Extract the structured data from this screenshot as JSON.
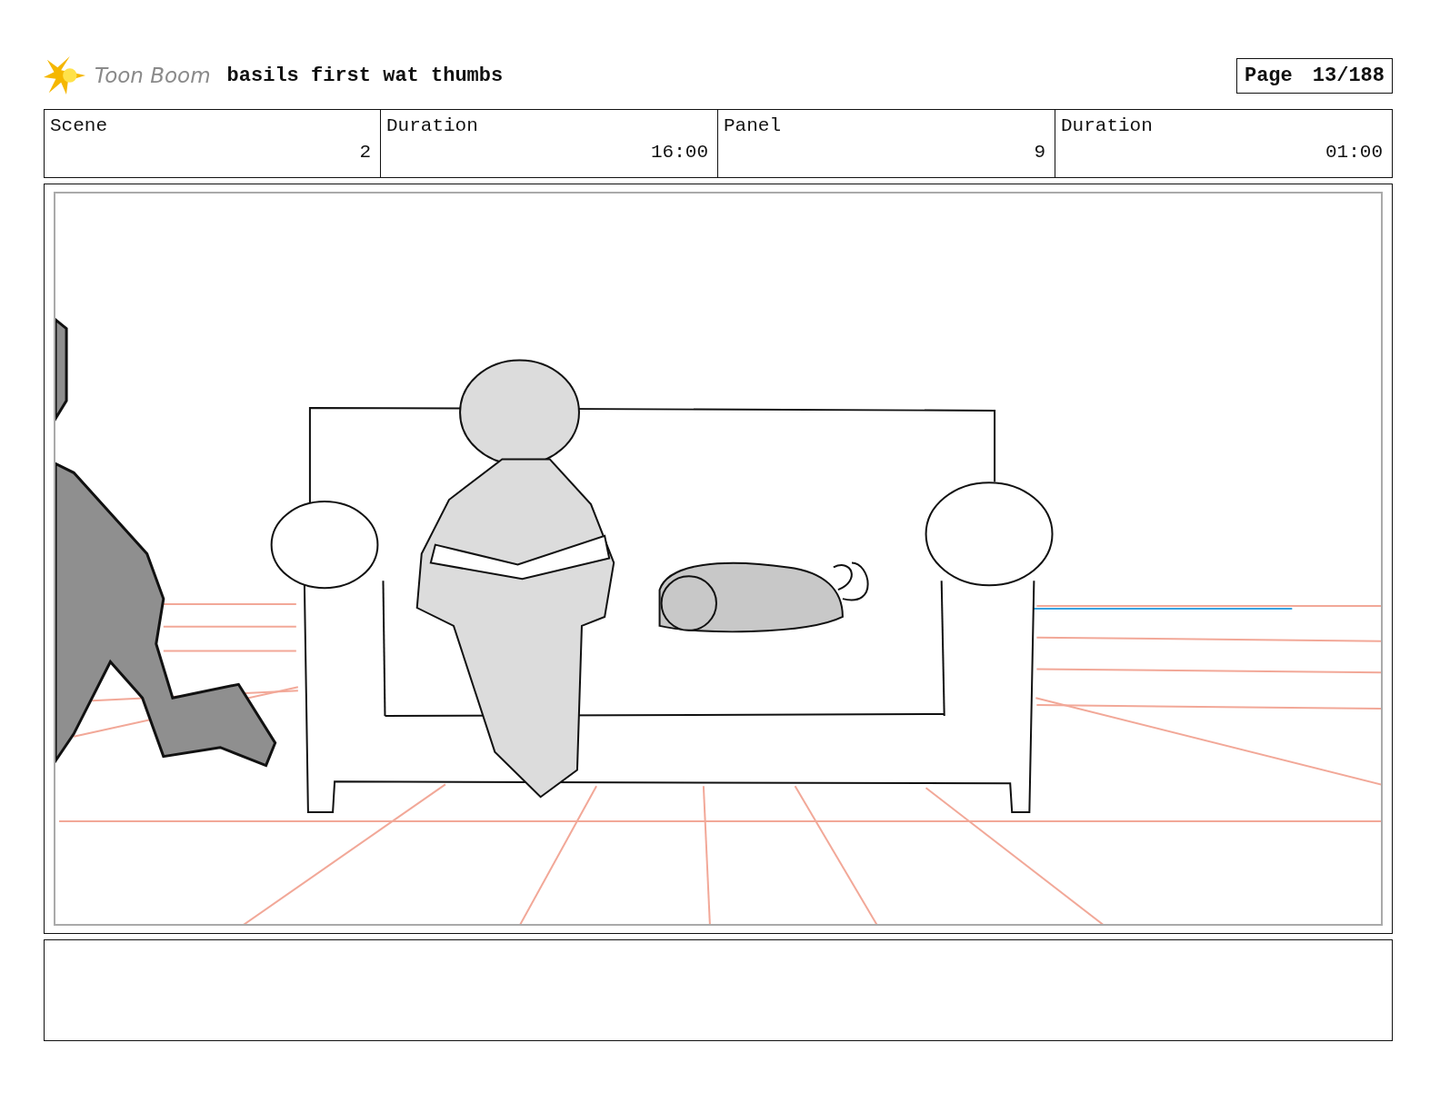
{
  "header": {
    "logo_text": "Toon Boom",
    "title": "basils first wat thumbs",
    "page_label": "Page",
    "page_number": "13/188"
  },
  "info_table": {
    "columns": [
      "Scene",
      "Duration",
      "Panel",
      "Duration"
    ],
    "rows": [
      [
        "2",
        "16:00",
        "9",
        "01:00"
      ]
    ]
  },
  "panel": {
    "kind": "sketch"
  }
}
